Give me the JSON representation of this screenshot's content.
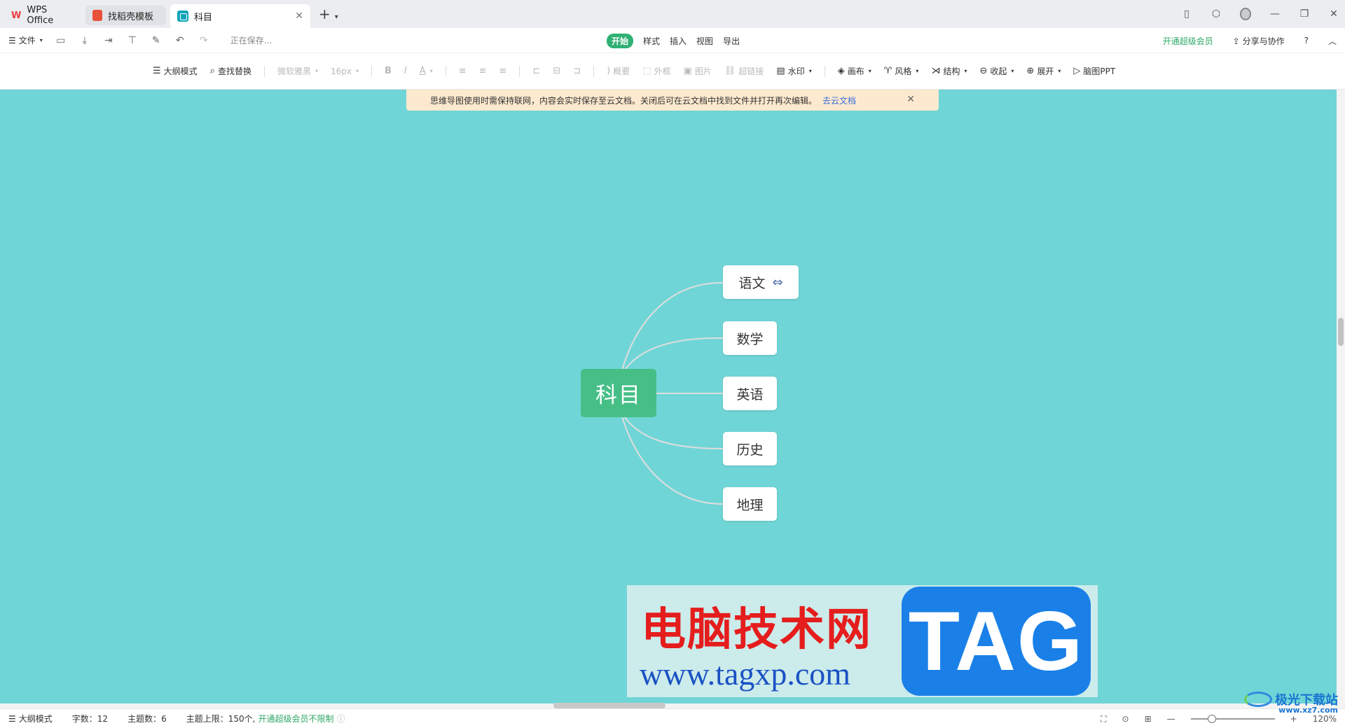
{
  "tabs": [
    {
      "label": "WPS Office",
      "icon": "wps-logo-icon"
    },
    {
      "label": "找稻壳模板",
      "icon": "template-icon"
    },
    {
      "label": "科目",
      "icon": "mindmap-icon"
    }
  ],
  "menu": {
    "file": "文件",
    "saving_status": "正在保存...",
    "tabs": [
      "开始",
      "样式",
      "插入",
      "视图",
      "导出"
    ],
    "vip": "开通超级会员",
    "share": "分享与协作"
  },
  "toolbar": {
    "outline": "大纲模式",
    "find_replace": "查找替换",
    "font": "微软雅黑",
    "font_size": "16px",
    "summary": "概要",
    "frame": "外框",
    "image": "图片",
    "hyperlink": "超链接",
    "watermark": "水印",
    "canvas": "画布",
    "style": "风格",
    "structure": "结构",
    "collapse": "收起",
    "expand": "展开",
    "to_ppt": "脑图PPT"
  },
  "notice": {
    "text": "思维导图使用时需保持联网，内容会实时保存至云文档。关闭后可在云文档中找到文件并打开再次编辑。",
    "link": "去云文档"
  },
  "mindmap": {
    "root": "科目",
    "children": [
      "语文",
      "数学",
      "英语",
      "历史",
      "地理"
    ],
    "canvas_color": "#70d5d6",
    "root_color": "#46bf87"
  },
  "watermark": {
    "title": "电脑技术网",
    "url": "www.tagxp.com",
    "tag": "TAG"
  },
  "statusbar": {
    "outline": "大纲模式",
    "word_count": "字数：12",
    "topic_count": "主题数：6",
    "topic_limit": "主题上限：150个,",
    "vip_unlimited": "开通超级会员不限制",
    "zoom": "120%"
  },
  "corner_logo": {
    "name": "极光下载站",
    "url": "www.xz7.com"
  }
}
